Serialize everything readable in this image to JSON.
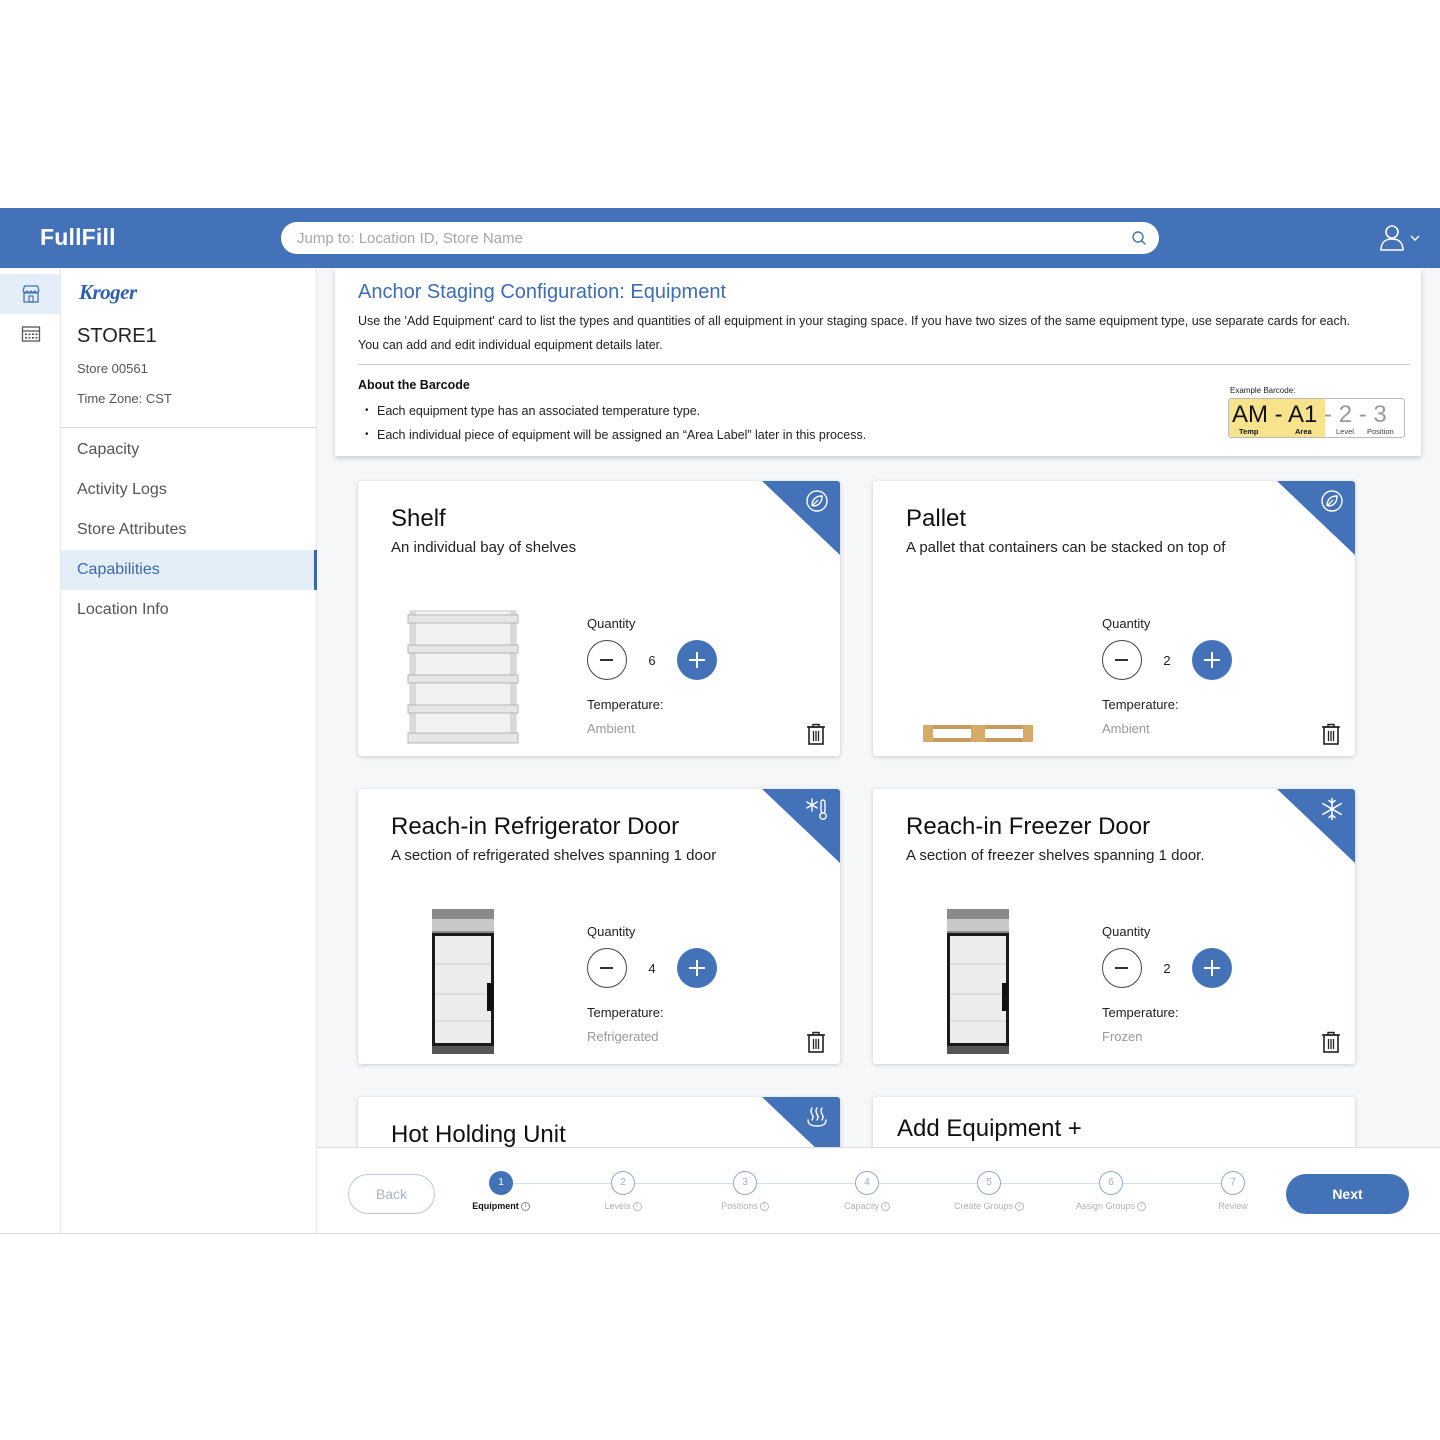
{
  "app": {
    "brand": "FullFill"
  },
  "search": {
    "placeholder": "Jump to: Location ID, Store Name"
  },
  "store": {
    "logo": "Kroger",
    "name": "STORE1",
    "number": "Store 00561",
    "timezone": "Time Zone: CST"
  },
  "nav": {
    "items": [
      "Capacity",
      "Activity Logs",
      "Store Attributes",
      "Capabilities",
      "Location Info"
    ],
    "active": "Capabilities"
  },
  "info": {
    "title": "Anchor Staging Configuration: Equipment",
    "description": "Use the 'Add Equipment' card to list the types and quantities of all equipment in your staging space. If you have two sizes of the same equipment type, use separate cards for each. You can add and edit individual equipment details later.",
    "about_title": "About the Barcode",
    "about_items": [
      "Each equipment type has an associated temperature type.",
      "Each individual piece of equipment will be assigned an “Area Label” later in this process."
    ],
    "barcode": {
      "caption": "Example Barcode:",
      "temp": "AM",
      "area": "A1",
      "level": "2",
      "position": "3",
      "sep": "-",
      "labels": {
        "temp": "Temp",
        "area": "Area",
        "level": "Level",
        "position": "Position"
      }
    }
  },
  "quantity_label": "Quantity",
  "temperature_label": "Temperature:",
  "cards": [
    {
      "title": "Shelf",
      "description": "An individual bay of shelves",
      "quantity": "6",
      "temperature": "Ambient",
      "icon": "leaf-icon",
      "image": "shelf-image"
    },
    {
      "title": "Pallet",
      "description": "A pallet that containers can be stacked on top of",
      "quantity": "2",
      "temperature": "Ambient",
      "icon": "leaf-icon",
      "image": "pallet-image"
    },
    {
      "title": "Reach-in Refrigerator Door",
      "description": "A section of refrigerated shelves spanning 1 door",
      "quantity": "4",
      "temperature": "Refrigerated",
      "icon": "snowflake-thermometer-icon",
      "image": "refrigerator-door-image"
    },
    {
      "title": "Reach-in Freezer Door",
      "description": "A section of freezer shelves spanning 1 door.",
      "quantity": "2",
      "temperature": "Frozen",
      "icon": "snowflake-icon",
      "image": "freezer-door-image"
    },
    {
      "title": "Hot Holding Unit",
      "icon": "heat-icon"
    }
  ],
  "add_card": {
    "label": "Add Equipment +"
  },
  "footer": {
    "back": "Back",
    "next": "Next",
    "steps": [
      {
        "num": "1",
        "label": "Equipment"
      },
      {
        "num": "2",
        "label": "Levels"
      },
      {
        "num": "3",
        "label": "Positions"
      },
      {
        "num": "4",
        "label": "Capacity"
      },
      {
        "num": "5",
        "label": "Create Groups"
      },
      {
        "num": "6",
        "label": "Assign Groups"
      },
      {
        "num": "7",
        "label": "Review"
      }
    ],
    "current_step": 1
  },
  "colors": {
    "primary": "#4472b9",
    "highlight": "#f7e38c",
    "nav_active_bg": "#e4eef8"
  }
}
